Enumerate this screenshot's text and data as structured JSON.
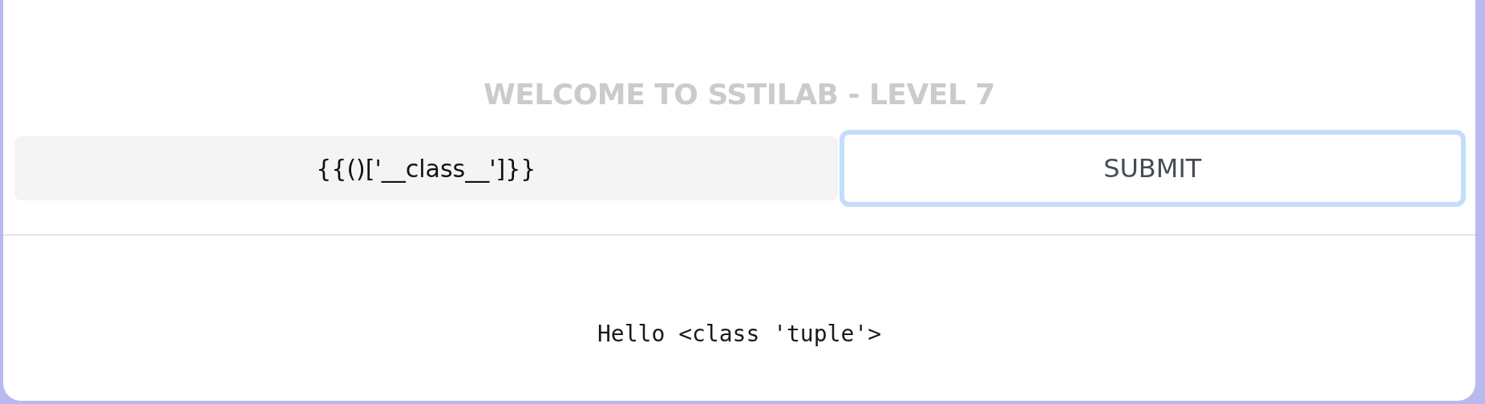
{
  "title": "WELCOME TO SSTILAB - LEVEL 7",
  "form": {
    "input": {
      "value": "{{()['__class__']}}"
    },
    "button": {
      "label": "SUBMIT",
      "focused": true
    }
  },
  "output": "Hello <class 'tuple'>"
}
